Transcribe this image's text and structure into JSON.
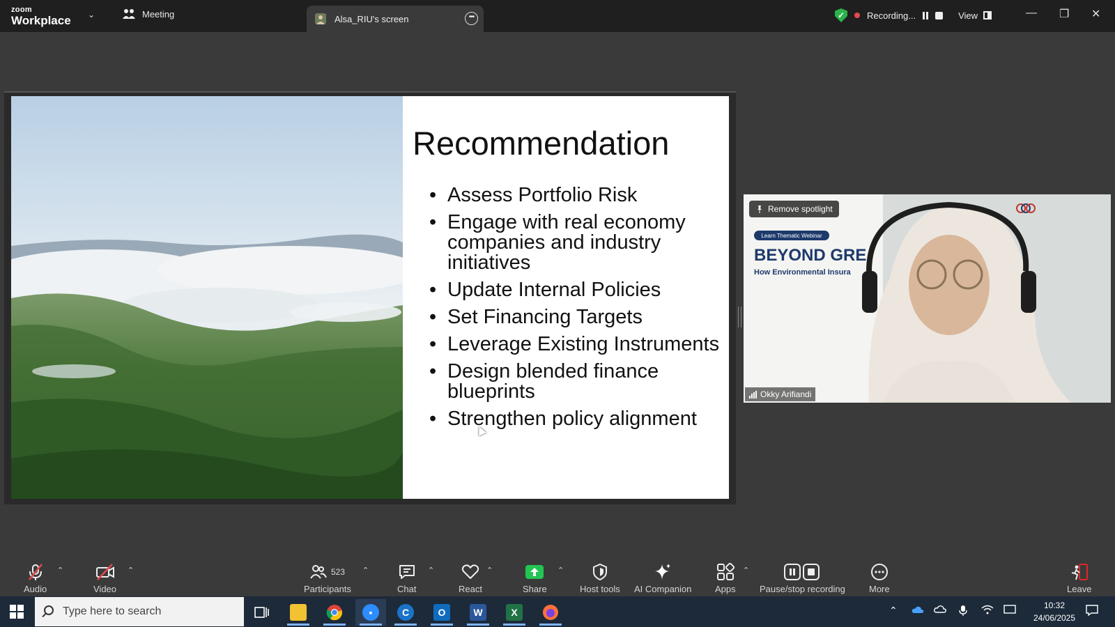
{
  "app": {
    "logo_small": "zoom",
    "logo_big": "Workplace"
  },
  "tabs": {
    "meeting": "Meeting",
    "screen_share": "Alsa_RIU's screen"
  },
  "recording": {
    "status": "Recording...",
    "view_label": "View"
  },
  "slide": {
    "title": "Recommendation",
    "bullets": [
      "Assess Portfolio Risk",
      "Engage with real economy companies and industry initiatives",
      "Update Internal Policies",
      "Set Financing Targets",
      "Leverage Existing Instruments",
      "Design blended finance blueprints",
      "Strengthen policy alignment"
    ]
  },
  "video": {
    "spotlight_label": "Remove spotlight",
    "participant_name": "Okky Arifiandi",
    "background_heading": "BEYOND GRE",
    "background_sub": "How Environmental Insura",
    "background_tag": "Learn Thematic Webinar"
  },
  "toolbar": {
    "audio": "Audio",
    "video": "Video",
    "participants": "Participants",
    "participants_count": "523",
    "chat": "Chat",
    "react": "React",
    "share": "Share",
    "host_tools": "Host tools",
    "ai_companion": "AI Companion",
    "apps": "Apps",
    "pause_stop": "Pause/stop recording",
    "more": "More",
    "leave": "Leave"
  },
  "taskbar": {
    "search_placeholder": "Type here to search",
    "time": "10:32",
    "date": "24/06/2025"
  },
  "colors": {
    "share_green": "#23c552",
    "leave_red": "#e02828",
    "muted_red": "#e5484d",
    "secure_green": "#2ab34b"
  }
}
